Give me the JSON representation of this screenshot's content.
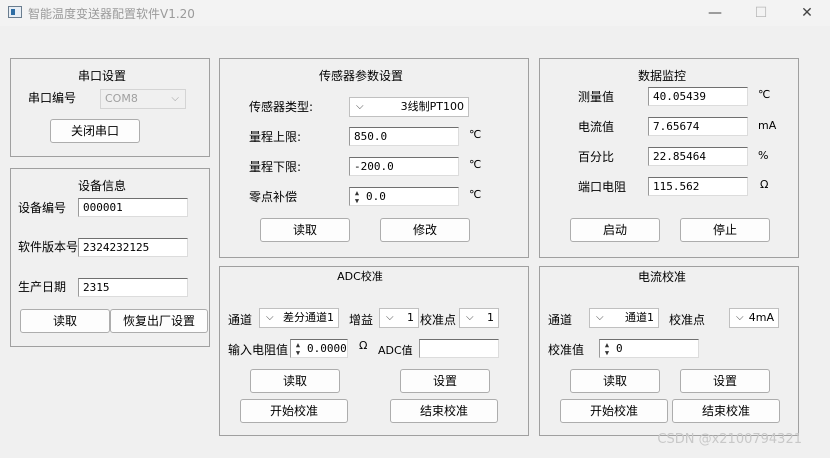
{
  "window": {
    "title": "智能温度变送器配置软件V1.20",
    "minimize_glyph": "—",
    "maximize_glyph": "☐",
    "close_glyph": "✕"
  },
  "serial": {
    "title": "串口设置",
    "port_label": "串口编号",
    "port_value": "COM8",
    "close_button": "关闭串口"
  },
  "device": {
    "title": "设备信息",
    "id_label": "设备编号",
    "id_value": "000001",
    "version_label": "软件版本号",
    "version_value": "2324232125",
    "date_label": "生产日期",
    "date_value": "2315",
    "read_button": "读取",
    "reset_button": "恢复出厂设置"
  },
  "sensor": {
    "title": "传感器参数设置",
    "type_label": "传感器类型:",
    "type_value": "3线制PT100",
    "upper_label": "量程上限:",
    "upper_value": "850.0",
    "lower_label": "量程下限:",
    "lower_value": "-200.0",
    "zero_label": "零点补偿",
    "zero_value": "0.0",
    "unit": "℃",
    "read_button": "读取",
    "modify_button": "修改"
  },
  "monitor": {
    "title": "数据监控",
    "measured_label": "测量值",
    "measured_value": "40.05439",
    "measured_unit": "℃",
    "current_label": "电流值",
    "current_value": "7.65674",
    "current_unit": "mA",
    "percent_label": "百分比",
    "percent_value": "22.85464",
    "percent_unit": "%",
    "resistance_label": "端口电阻",
    "resistance_value": "115.562",
    "resistance_unit": "Ω",
    "start_button": "启动",
    "stop_button": "停止"
  },
  "adc": {
    "title": "ADC校准",
    "channel_label": "通道",
    "channel_value": "差分通道1",
    "gain_label": "增益",
    "gain_value": "1",
    "point_label": "校准点",
    "point_value": "1",
    "input_res_label": "输入电阻值",
    "input_res_value": "0.0000",
    "ohm_unit": "Ω",
    "adc_value_label": "ADC值",
    "adc_value": "",
    "read_button": "读取",
    "set_button": "设置",
    "start_button": "开始校准",
    "end_button": "结束校准"
  },
  "current_cal": {
    "title": "电流校准",
    "channel_label": "通道",
    "channel_value": "通道1",
    "point_label": "校准点",
    "point_value": "4mA",
    "value_label": "校准值",
    "value": "0",
    "read_button": "读取",
    "set_button": "设置",
    "start_button": "开始校准",
    "end_button": "结束校准"
  },
  "watermark": "CSDN @x2100794321"
}
